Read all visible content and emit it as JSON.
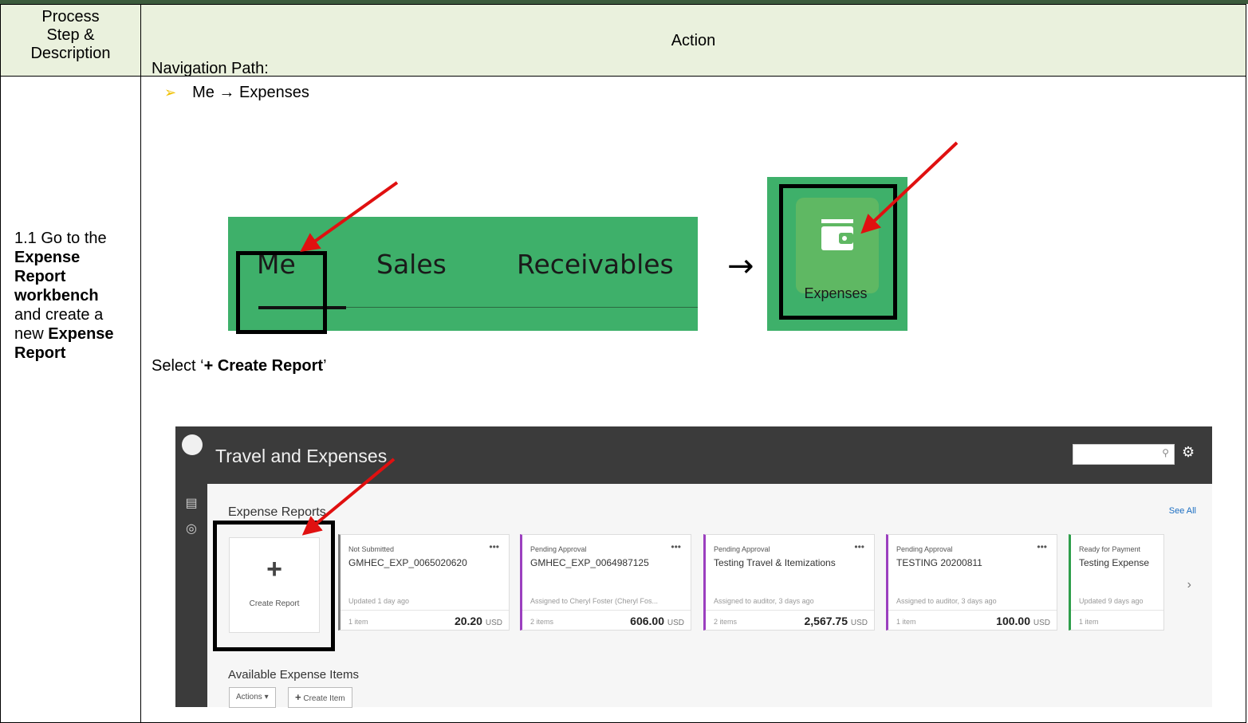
{
  "header": {
    "col1_line1": "Process",
    "col1_line2": "Step &",
    "col1_line3": "Description",
    "col2": "Action"
  },
  "step": {
    "prefix": "1.1 Go to the",
    "bold1": "Expense Report workbench",
    "mid": "and create a new",
    "bold2": "Expense Report"
  },
  "nav": {
    "label": "Navigation Path:",
    "path": "Me → Expenses",
    "tabs": [
      "Me",
      "Sales",
      "Receivables"
    ],
    "tile_label": "Expenses"
  },
  "instruction": {
    "pre": "Select ‘",
    "bold": "+ Create Report",
    "post": "’"
  },
  "app": {
    "title": "Travel and Expenses",
    "section": "Expense Reports",
    "see_all": "See All",
    "create_label": "Create Report",
    "cards": [
      {
        "status": "Not Submitted",
        "name": "GMHEC_EXP_0065020620",
        "sub": "Updated 1 day ago",
        "items": "1 item",
        "amount": "20.20",
        "currency": "USD",
        "color": "#7a7a7a"
      },
      {
        "status": "Pending Approval",
        "name": "GMHEC_EXP_0064987125",
        "sub": "Assigned to Cheryl Foster (Cheryl Fos...",
        "items": "2 items",
        "amount": "606.00",
        "currency": "USD",
        "color": "#9b3fbf"
      },
      {
        "status": "Pending Approval",
        "name": "Testing Travel & Itemizations",
        "sub": "Assigned to auditor, 3 days ago",
        "items": "2 items",
        "amount": "2,567.75",
        "currency": "USD",
        "color": "#9b3fbf"
      },
      {
        "status": "Pending Approval",
        "name": "TESTING 20200811",
        "sub": "Assigned to auditor, 3 days ago",
        "items": "1 item",
        "amount": "100.00",
        "currency": "USD",
        "color": "#9b3fbf"
      },
      {
        "status": "Ready for Payment",
        "name": "Testing Expense",
        "sub": "Updated 9 days ago",
        "items": "1 item",
        "amount": "",
        "currency": "",
        "color": "#2e9e4a"
      }
    ],
    "available": "Available Expense Items",
    "actions_btn": "Actions ▾",
    "create_item_btn": "Create Item"
  },
  "colors": {
    "header_bg": "#eaf1dd",
    "nav_green": "#3eb06a",
    "arrow_red": "#e01010"
  }
}
